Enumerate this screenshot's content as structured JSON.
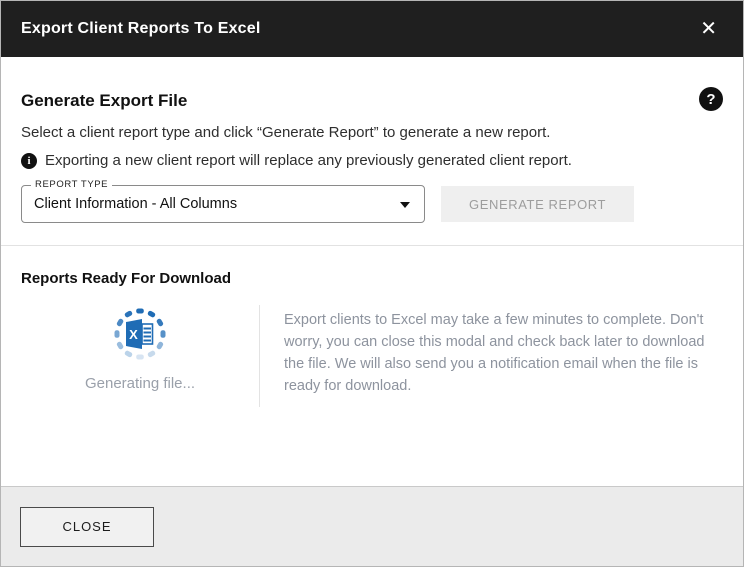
{
  "modal": {
    "title": "Export Client Reports To Excel",
    "close_icon": "✕"
  },
  "generate_section": {
    "heading": "Generate Export File",
    "help_icon": "?",
    "description": "Select a client report type and click “Generate Report” to generate a new report.",
    "info_icon": "i",
    "info_note": "Exporting a new client report will replace any previously generated client report.",
    "report_type": {
      "label": "REPORT TYPE",
      "value": "Client Information - All Columns"
    },
    "generate_button_label": "GENERATE REPORT"
  },
  "download_section": {
    "heading": "Reports Ready For Download",
    "excel_icon_letter": "X",
    "status_text": "Generating file...",
    "message": "Export clients to Excel may take a few minutes to complete. Don't worry, you can close this modal and check back later to download the file. We will also send you a notification email when the file is ready for download."
  },
  "footer": {
    "close_button_label": "CLOSE"
  },
  "colors": {
    "header_bg": "#1f1f1f",
    "accent_blue": "#1f6cb5",
    "muted_text": "#8d939e",
    "disabled_button_bg": "#efefef"
  }
}
